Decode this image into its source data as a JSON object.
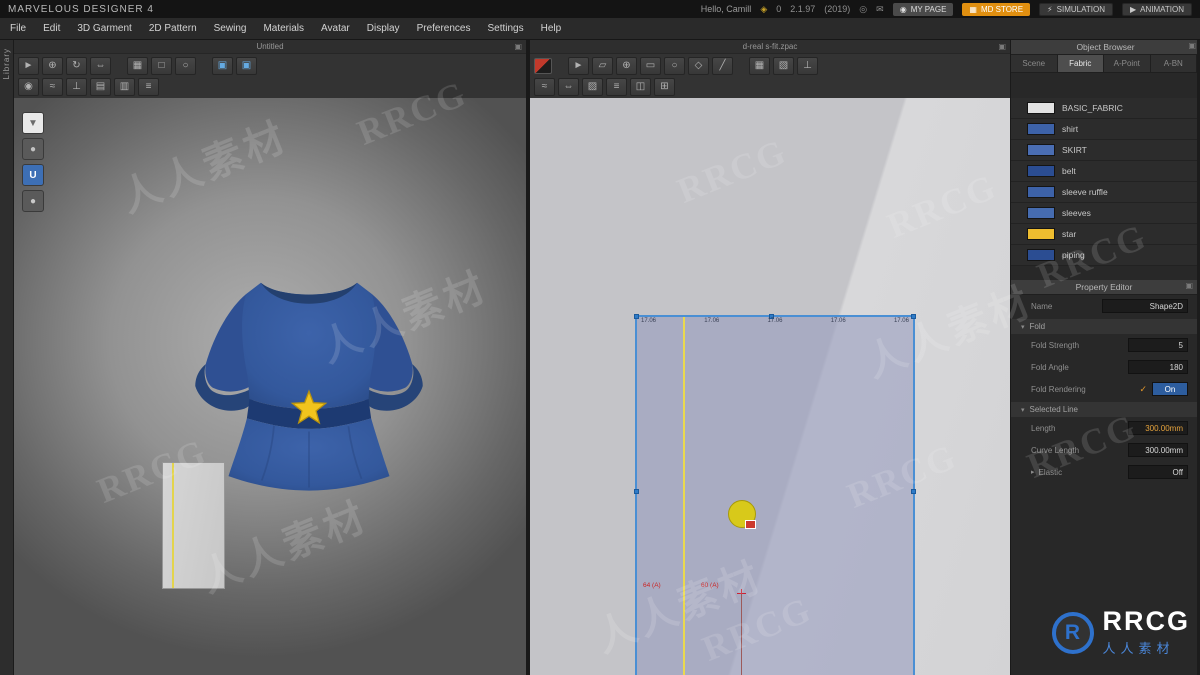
{
  "titlebar": {
    "app_title": "MARVELOUS DESIGNER 4",
    "greeting": "Hello, Camill",
    "coin": "0",
    "version": "2.1.97",
    "build": "(2019)",
    "my_page": "MY PAGE",
    "md_store": "MD STORE",
    "simulation": "SIMULATION",
    "animation": "ANIMATION"
  },
  "menubar": {
    "items": [
      "File",
      "Edit",
      "3D Garment",
      "2D Pattern",
      "Sewing",
      "Materials",
      "Avatar",
      "Display",
      "Preferences",
      "Settings",
      "Help"
    ]
  },
  "left_strip": {
    "label": "Library"
  },
  "viewport3d": {
    "title": "Untitled"
  },
  "viewport2d": {
    "title": "d-real s-fit.zpac",
    "top_measurements": [
      "17.06",
      "17.06",
      "17.06",
      "17.06",
      "17.06"
    ],
    "bottom_measurements": [
      "64 (A)",
      "60 (A)"
    ]
  },
  "toolbars": {
    "v3d_row1": [
      "►",
      "⊕",
      "↻",
      "⇔",
      "▦",
      "□",
      "○",
      "▣",
      "▣"
    ],
    "v3d_row2": [
      "◉",
      "≈",
      "⊥",
      "▤",
      "▥",
      "≡"
    ],
    "v2d_row1": [
      "►",
      "▱",
      "⊕",
      "▭",
      "○",
      "◇",
      "╱",
      "▦",
      "▧",
      "⊥"
    ],
    "v2d_row2": [
      "≈",
      "⇔",
      "▨",
      "≡",
      "◫",
      "⊞"
    ]
  },
  "avatar_tiles": [
    "▼",
    "●",
    "U",
    "●"
  ],
  "object_browser": {
    "title": "Object Browser",
    "tabs": [
      "Scene",
      "Fabric",
      "A-Point",
      "A-BN"
    ],
    "items": [
      {
        "name": "BASIC_FABRIC",
        "color": "#e2e2e2"
      },
      {
        "name": "shirt",
        "color": "#3d62a8"
      },
      {
        "name": "SKIRT",
        "color": "#4a6db2"
      },
      {
        "name": "belt",
        "color": "#2b4d92"
      },
      {
        "name": "sleeve ruffle",
        "color": "#3d62a8"
      },
      {
        "name": "sleeves",
        "color": "#466cb0"
      },
      {
        "name": "star",
        "color": "#eebd2f"
      },
      {
        "name": "piping",
        "color": "#2b4d92"
      }
    ]
  },
  "property_editor": {
    "title": "Property Editor",
    "name_label": "Name",
    "name_value": "Shape2D",
    "fold": {
      "section": "Fold",
      "strength_label": "Fold Strength",
      "strength_value": "5",
      "angle_label": "Fold Angle",
      "angle_value": "180",
      "rendering_label": "Fold Rendering",
      "rendering_value": "On"
    },
    "selected_line": {
      "section": "Selected Line",
      "length_label": "Length",
      "length_value": "300.00mm",
      "curve_label": "Curve Length",
      "curve_value": "300.00mm",
      "elastic_label": "Elastic",
      "elastic_value": "Off"
    }
  },
  "icons": {
    "coin": "◈",
    "notification": "◎",
    "mail": "✉",
    "user": "◉",
    "cart": "▦",
    "lightning": "⚡",
    "play": "▶",
    "panel_menu": "▣",
    "section_open": "▾",
    "section_closed": "▸",
    "check": "✓"
  },
  "watermark": {
    "cn": "人人素材",
    "en": "RRCG"
  },
  "logo": {
    "mark": "R",
    "brand": "RRCG",
    "caption": "人人素材"
  }
}
